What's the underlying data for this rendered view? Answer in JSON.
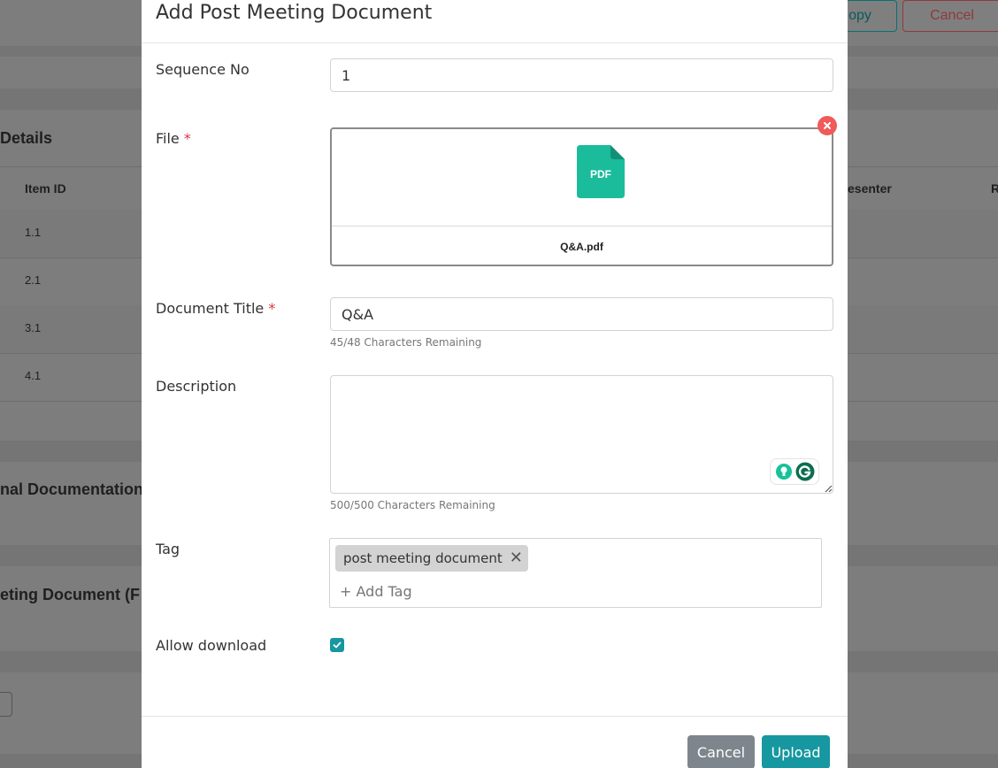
{
  "background": {
    "top_buttons": {
      "copy": "opy",
      "cancel": "Cancel"
    },
    "sections": {
      "details": "Details",
      "documentation": "nal Documentation",
      "meeting_doc": "eting Document (F"
    },
    "table": {
      "headers": {
        "item_id": "Item ID",
        "presenter": "esenter",
        "last": "R"
      },
      "rows": [
        "1.1",
        "2.1",
        "3.1",
        "4.1"
      ]
    }
  },
  "modal": {
    "title": "Add Post Meeting Document",
    "sequence": {
      "label": "Sequence No",
      "value": "1"
    },
    "file": {
      "label": "File",
      "required_mark": "*",
      "icon_text": "PDF",
      "file_name": "Q&A.pdf"
    },
    "document_title": {
      "label": "Document Title",
      "required_mark": "*",
      "value": "Q&A",
      "hint": "45/48 Characters Remaining"
    },
    "description": {
      "label": "Description",
      "value": "",
      "hint": "500/500 Characters Remaining"
    },
    "tag": {
      "label": "Tag",
      "chips": [
        "post meeting document"
      ],
      "add_placeholder": "+ Add Tag"
    },
    "allow_download": {
      "label": "Allow download",
      "checked": true
    },
    "footer": {
      "cancel_label": "Cancel",
      "upload_label": "Upload"
    }
  },
  "colors": {
    "accent": "#17979f",
    "danger": "#dc3545",
    "pdf": "#1abc9c",
    "remove": "#f05a5a"
  }
}
